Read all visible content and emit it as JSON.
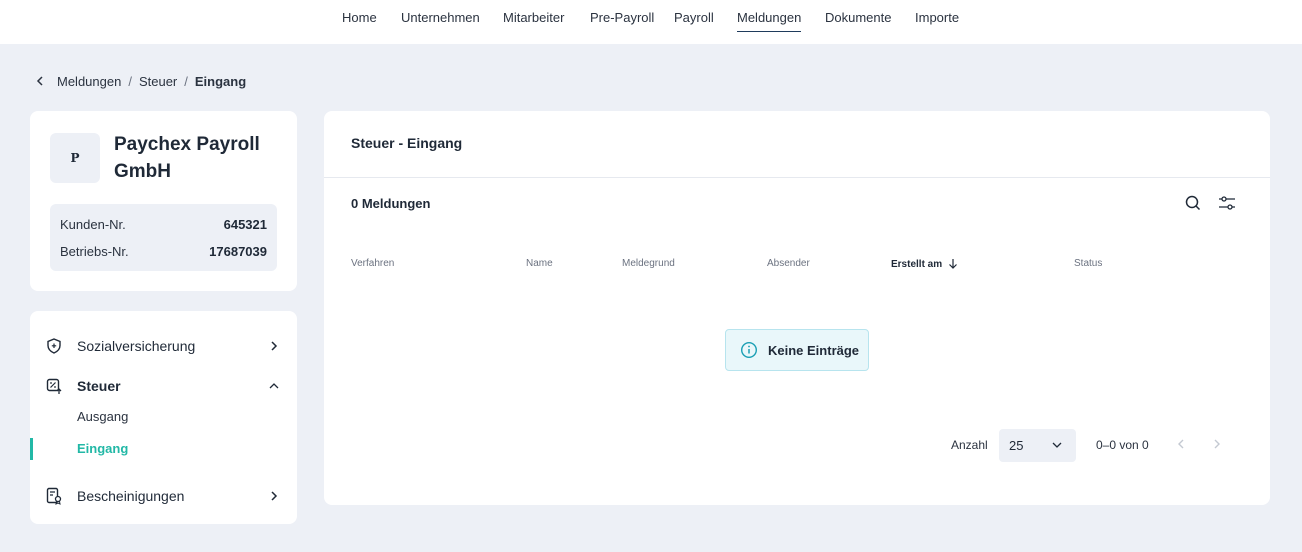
{
  "nav": {
    "items": [
      {
        "label": "Home"
      },
      {
        "label": "Unternehmen"
      },
      {
        "label": "Mitarbeiter"
      },
      {
        "label": "Pre-Payroll"
      },
      {
        "label": "Payroll"
      },
      {
        "label": "Meldungen"
      },
      {
        "label": "Dokumente"
      },
      {
        "label": "Importe"
      }
    ],
    "active": "Meldungen"
  },
  "breadcrumb": {
    "items": [
      "Meldungen",
      "Steuer",
      "Eingang"
    ],
    "separator": "/"
  },
  "company": {
    "avatar_letter": "P",
    "name": "Paychex Payroll GmbH",
    "customer_label": "Kunden-Nr.",
    "customer_value": "645321",
    "business_label": "Betriebs-Nr.",
    "business_value": "17687039"
  },
  "menu": {
    "social": "Sozialversicherung",
    "tax": "Steuer",
    "tax_out": "Ausgang",
    "tax_in": "Eingang",
    "certificates": "Bescheinigungen"
  },
  "main": {
    "title": "Steuer - Eingang",
    "count": "0 Meldungen",
    "columns": [
      "Verfahren",
      "Name",
      "Meldegrund",
      "Absender",
      "Erstellt am",
      "Status"
    ],
    "sorted_column": "Erstellt am",
    "empty": "Keine Einträge",
    "pager_label": "Anzahl",
    "page_size": "25",
    "range": "0–0 von 0"
  },
  "colors": {
    "accent": "#22b8a6",
    "background": "#edf0f6",
    "info_bg": "#e9f7fa"
  }
}
